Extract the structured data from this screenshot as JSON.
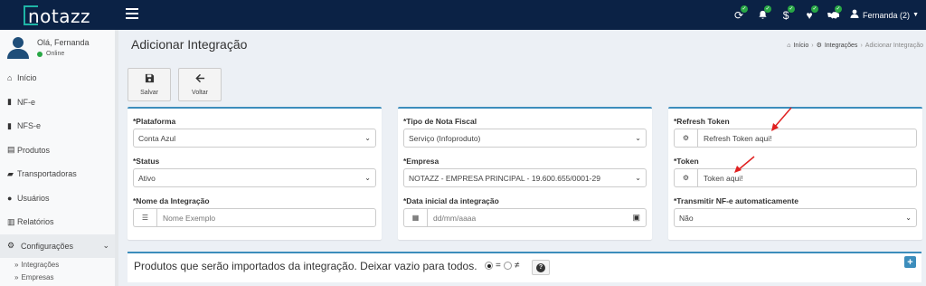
{
  "app": {
    "logo": "notazz"
  },
  "topbar": {
    "icons": [
      "sync-icon",
      "bell-icon",
      "dollar-icon",
      "heart-icon",
      "handshake-icon"
    ],
    "user_label": "Fernanda (2)"
  },
  "sidebar": {
    "greeting": "Olá, Fernanda",
    "status": "Online",
    "items": [
      {
        "label": "Início",
        "icon": "home-icon"
      },
      {
        "label": "NF-e",
        "icon": "file-icon"
      },
      {
        "label": "NFS-e",
        "icon": "file-icon"
      },
      {
        "label": "Produtos",
        "icon": "archive-icon"
      },
      {
        "label": "Transportadoras",
        "icon": "truck-icon"
      },
      {
        "label": "Usuários",
        "icon": "user-icon"
      },
      {
        "label": "Relatórios",
        "icon": "bar-chart-icon"
      },
      {
        "label": "Configurações",
        "icon": "gear-icon"
      }
    ],
    "subitems": [
      {
        "label": "Integrações"
      },
      {
        "label": "Empresas"
      }
    ]
  },
  "header": {
    "title": "Adicionar Integração",
    "breadcrumb": [
      "Início",
      "Integrações",
      "Adicionar Integração"
    ]
  },
  "toolbar": {
    "save_label": "Salvar",
    "back_label": "Voltar"
  },
  "col1": {
    "platform_label": "*Plataforma",
    "platform_value": "Conta Azul",
    "status_label": "*Status",
    "status_value": "Ativo",
    "name_label": "*Nome da Integração",
    "name_placeholder": "Nome Exemplo"
  },
  "col2": {
    "invoice_type_label": "*Tipo de Nota Fiscal",
    "invoice_type_value": "Serviço (Infoproduto)",
    "company_label": "*Empresa",
    "company_value": "NOTAZZ - EMPRESA PRINCIPAL - 19.600.655/0001-29",
    "start_date_label": "*Data inicial da integração",
    "start_date_placeholder": "dd/mm/aaaa"
  },
  "col3": {
    "refresh_token_label": "*Refresh Token",
    "refresh_token_value": "Refresh Token aqui!",
    "token_label": "*Token",
    "token_value": "Token aqui!",
    "auto_nfe_label": "*Transmitir NF-e automaticamente",
    "auto_nfe_value": "Não"
  },
  "products": {
    "title": "Produtos que serão importados da integração. Deixar vazio para todos.",
    "equal_symbol": "=",
    "not_equal_symbol": "≠",
    "help_label": "?",
    "add_label": "+"
  },
  "colors": {
    "topbar": "#0b2245",
    "accent": "#3c8dbc",
    "online": "#28a745",
    "annotation_arrow": "#e02020"
  }
}
